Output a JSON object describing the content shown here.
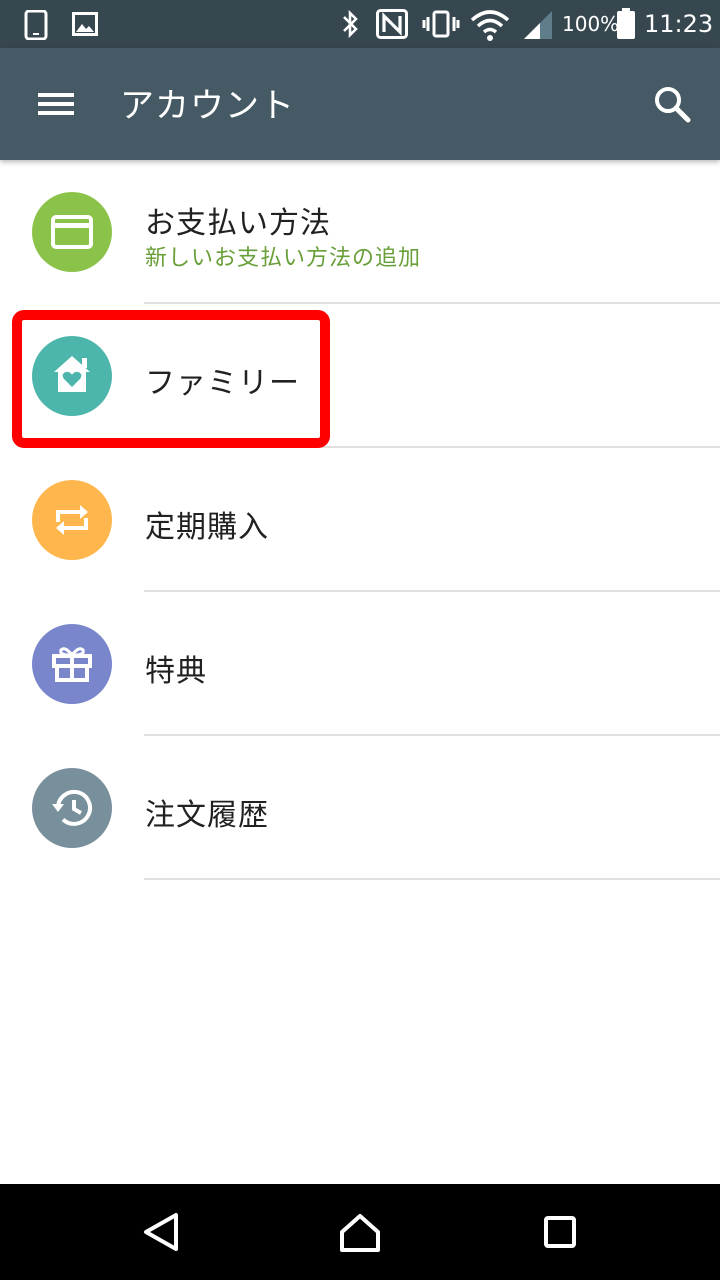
{
  "status_bar": {
    "battery_percent": "100%",
    "time": "11:23"
  },
  "app_bar": {
    "title": "アカウント",
    "menu_icon": "hamburger-menu-icon",
    "search_icon": "search-icon"
  },
  "list": {
    "items": [
      {
        "label": "お支払い方法",
        "sublabel": "新しいお支払い方法の追加",
        "icon": "credit-card-icon",
        "color": "#8bc34a"
      },
      {
        "label": "ファミリー",
        "icon": "family-home-icon",
        "color": "#4db6ac"
      },
      {
        "label": "定期購入",
        "icon": "repeat-icon",
        "color": "#ffb74d"
      },
      {
        "label": "特典",
        "icon": "gift-icon",
        "color": "#7986cb"
      },
      {
        "label": "注文履歴",
        "icon": "history-icon",
        "color": "#78909c"
      }
    ]
  },
  "annotation": {
    "highlight_color": "#ff0000"
  },
  "nav_bar": {
    "back_icon": "back-triangle-icon",
    "home_icon": "home-icon",
    "recents_icon": "recents-square-icon"
  },
  "colors": {
    "status_bar_bg": "#37474f",
    "app_bar_bg": "#455a64",
    "accent_green": "#689f38"
  }
}
